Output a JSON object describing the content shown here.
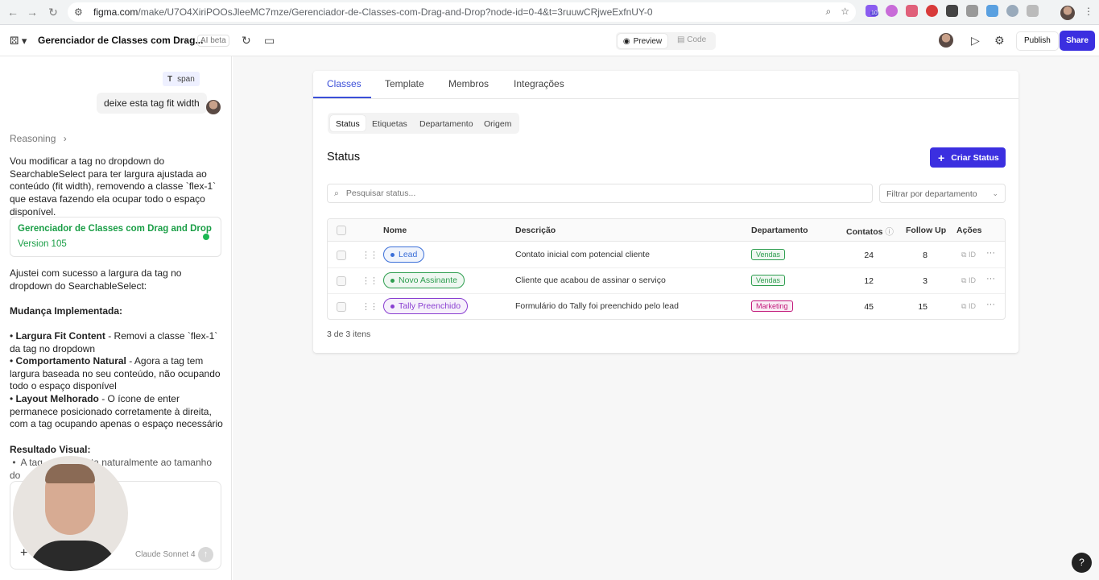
{
  "browser": {
    "url_domain": "figma.com",
    "url_path": "/make/U7O4XiriPOOsJleeMC7mze/Gerenciador-de-Classes-com-Drag-and-Drop?node-id=0-4&t=3ruuwCRjweExfnUY-0",
    "ext_badge": "10"
  },
  "topbar": {
    "project_title": "Gerenciador de Classes com Drag...",
    "beta_label": "AI beta",
    "preview_label": "Preview",
    "code_label": "Code",
    "publish_label": "Publish",
    "share_label": "Share"
  },
  "chat": {
    "span_chip": "span",
    "user_message": "deixe esta tag fit width",
    "reasoning_label": "Reasoning",
    "para1": "Vou modificar a tag no dropdown do SearchableSelect para ter largura ajustada ao conteúdo (fit width), removendo a classe `flex-1` que estava fazendo ela ocupar todo o espaço disponível.",
    "version_title": "Gerenciador de Classes com Drag and Drop",
    "version_label": "Version 105",
    "para2": "Ajustei com sucesso a largura da tag no dropdown do SearchableSelect:",
    "heading_changes": "Mudança Implementada:",
    "bullet1_bold": "Largura Fit Content",
    "bullet1_text": " - Removi a classe `flex-1` da tag no dropdown",
    "bullet2_bold": "Comportamento Natural",
    "bullet2_text": " - Agora a tag tem largura baseada no seu conteúdo, não ocupando todo o espaço disponível",
    "bullet3_bold": "Layout Melhorado",
    "bullet3_text": " - O ícone de enter permanece posicionado corretamente à direita, com a tag ocupando apenas o espaço necessário",
    "heading_result": "Resultado Visual:",
    "result_bullet_start": "A tag",
    "result_bullet_end": "ta naturalmente ao tamanho do",
    "model_label": "Claude Sonnet 4"
  },
  "app": {
    "tabs": [
      "Classes",
      "Template",
      "Membros",
      "Integrações"
    ],
    "subtabs": [
      "Status",
      "Etiquetas",
      "Departamento",
      "Origem"
    ],
    "section_title": "Status",
    "create_button": "Criar Status",
    "search_placeholder": "Pesquisar status...",
    "filter_placeholder": "Filtrar por departamento",
    "columns": [
      "Nome",
      "Descrição",
      "Departamento",
      "Contatos",
      "Follow Up",
      "Ações"
    ],
    "rows": [
      {
        "name": "Lead",
        "description": "Contato inicial com potencial cliente",
        "department": "Vendas",
        "contacts": "24",
        "followup": "8",
        "id_label": "ID",
        "pill_color": "#3b6fd8",
        "dept_color": "#2e9e4f"
      },
      {
        "name": "Novo Assinante",
        "description": "Cliente que acabou de assinar o serviço",
        "department": "Vendas",
        "contacts": "12",
        "followup": "3",
        "id_label": "ID",
        "pill_color": "#2e9e4f",
        "dept_color": "#2e9e4f"
      },
      {
        "name": "Tally Preenchido",
        "description": "Formulário do Tally foi preenchido pelo lead",
        "department": "Marketing",
        "contacts": "45",
        "followup": "15",
        "id_label": "ID",
        "pill_color": "#8a3fd1",
        "dept_color": "#c2187a"
      }
    ],
    "item_count": "3 de 3 itens"
  },
  "help_label": "?"
}
